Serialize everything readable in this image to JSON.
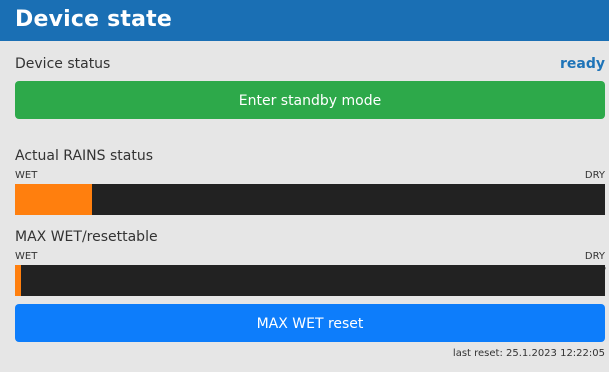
{
  "header": {
    "title": "Device state"
  },
  "device": {
    "label": "Device status",
    "value": "ready"
  },
  "buttons": {
    "standby": "Enter standby mode",
    "maxreset": "MAX WET reset"
  },
  "rains": {
    "title": "Actual RAINS status",
    "left": "WET",
    "right": "DRY",
    "fraction": 0.13
  },
  "maxwet": {
    "title": "MAX WET/resettable",
    "left": "WET",
    "right": "DRY",
    "fraction": 0.01
  },
  "footer": {
    "text": "last reset: 25.1.2023 12:22:05"
  },
  "colors": {
    "header": "#1a6fb4",
    "accent_green": "#2da94a",
    "accent_blue": "#0d7dfb",
    "bar_bg": "#222222",
    "bar_fill": "#ff7f0e",
    "status_ready": "#1f74b8"
  }
}
